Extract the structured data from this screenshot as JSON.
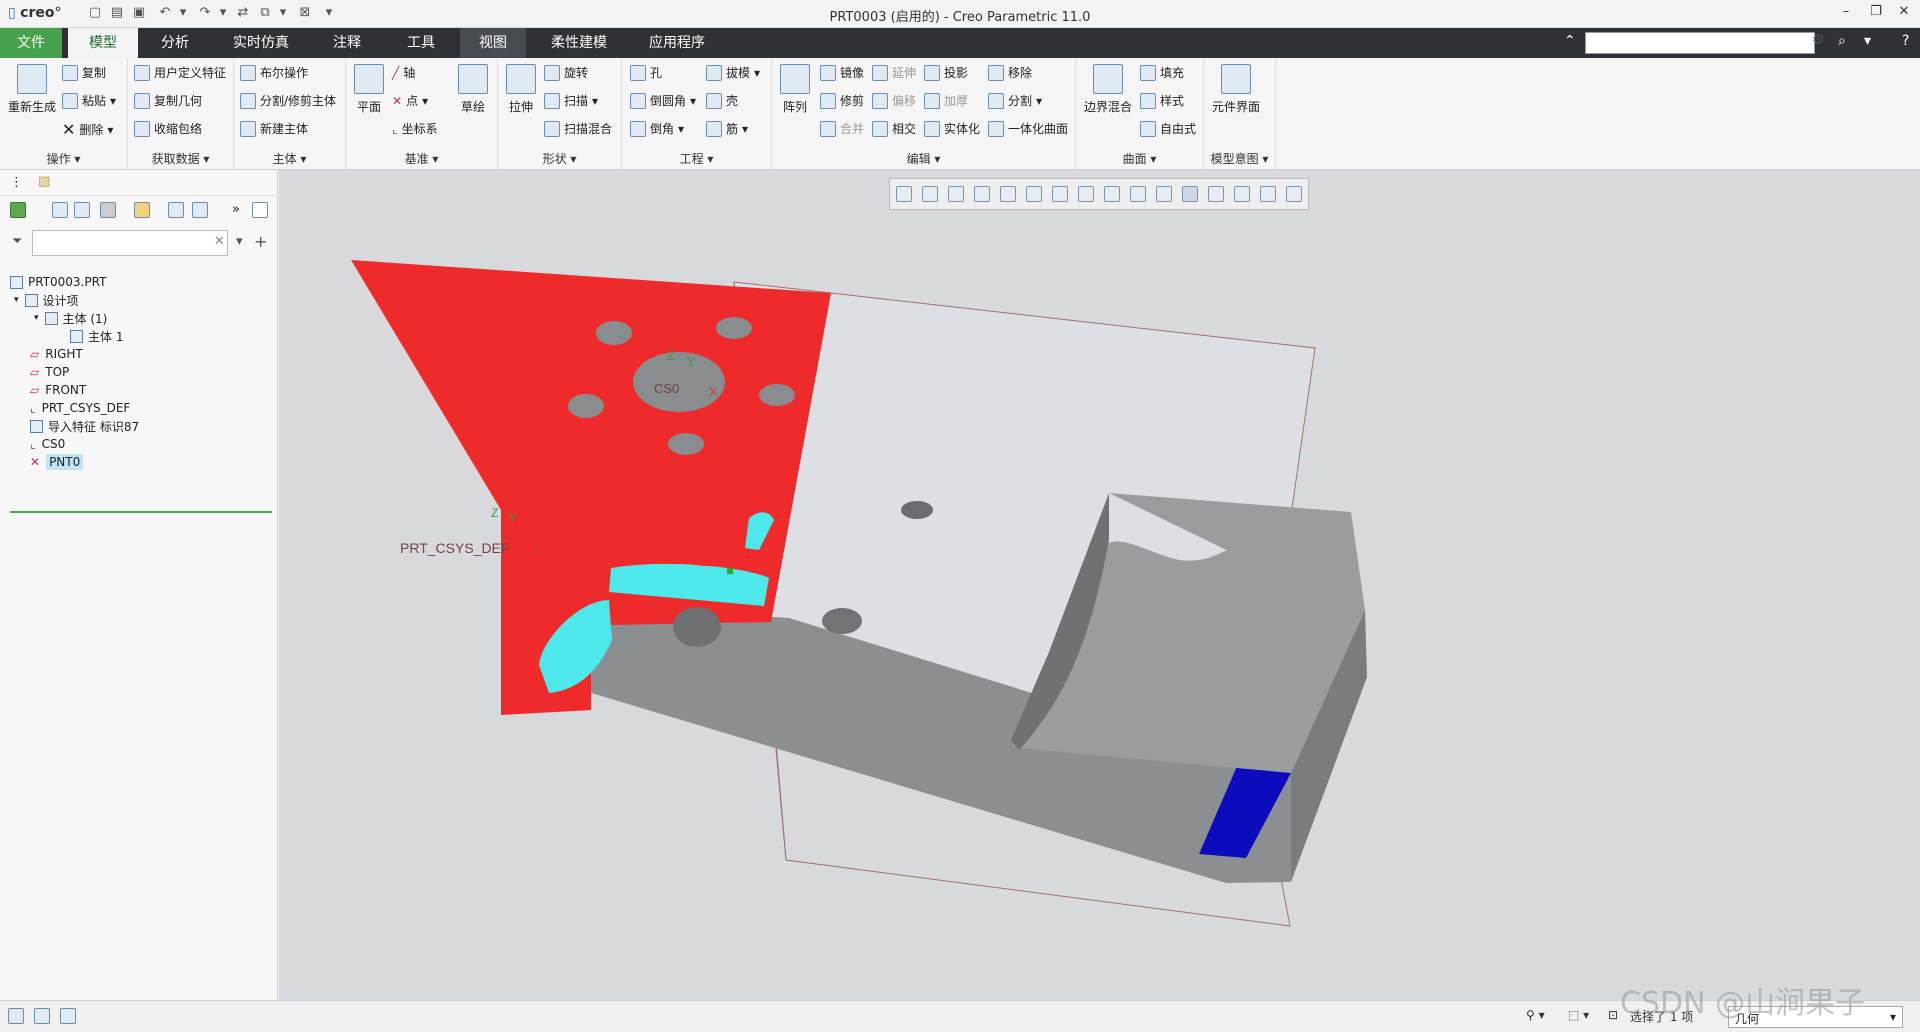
{
  "titlebar": {
    "logo_prefix": "creo",
    "window_title": "PRT0003 (启用的) - Creo Parametric 11.0",
    "min": "–",
    "restore": "❐",
    "close": "✕"
  },
  "menubar": {
    "tabs": [
      "文件",
      "模型",
      "分析",
      "实时仿真",
      "注释",
      "工具",
      "视图",
      "柔性建模",
      "应用程序"
    ],
    "active_tab": "模型",
    "search_placeholder": "",
    "help": "?"
  },
  "ribbon": {
    "operations": {
      "label": "操作",
      "regen": "重新生成",
      "copy": "复制",
      "paste": "粘贴",
      "delete": "删除"
    },
    "getdata": {
      "label": "获取数据",
      "udf": "用户定义特征",
      "copygeom": "复制几何",
      "shrinkwrap": "收缩包络"
    },
    "body": {
      "label": "主体",
      "boolean": "布尔操作",
      "split": "分割/修剪主体",
      "newbody": "新建主体"
    },
    "datum": {
      "label": "基准",
      "plane": "平面",
      "axis": "轴",
      "point": "点",
      "csys": "坐标系",
      "sketch": "草绘"
    },
    "shapes": {
      "label": "形状",
      "extrude": "拉伸",
      "revolve": "旋转",
      "sweep": "扫描",
      "sweptblend": "扫描混合"
    },
    "engineering": {
      "label": "工程",
      "hole": "孔",
      "round": "倒圆角",
      "chamfer": "倒角",
      "draft": "拔模",
      "shell": "壳",
      "rib": "筋"
    },
    "editing": {
      "label": "编辑",
      "pattern": "阵列",
      "mirror": "镜像",
      "extend": "延伸",
      "project": "投影",
      "trim": "修剪",
      "offset": "偏移",
      "thicken": "加厚",
      "merge": "合并",
      "intersect": "相交",
      "solidify": "实体化",
      "remove": "移除",
      "split": "分割",
      "unify": "一体化曲面"
    },
    "surfaces": {
      "label": "曲面",
      "boundary": "边界混合",
      "fill": "填充",
      "style": "样式",
      "freestyle": "自由式"
    },
    "intent": {
      "label": "模型意图",
      "component_interface": "元件界面"
    }
  },
  "tree": {
    "items": [
      {
        "label": "PRT0003.PRT",
        "indent": 0
      },
      {
        "label": "设计项",
        "indent": 1
      },
      {
        "label": "主体 (1)",
        "indent": 2
      },
      {
        "label": "主体 1",
        "indent": 3
      },
      {
        "label": "RIGHT",
        "indent": 1
      },
      {
        "label": "TOP",
        "indent": 1
      },
      {
        "label": "FRONT",
        "indent": 1
      },
      {
        "label": "PRT_CSYS_DEF",
        "indent": 1
      },
      {
        "label": "导入特征 标识87",
        "indent": 1
      },
      {
        "label": "CS0",
        "indent": 1
      },
      {
        "label": "PNT0",
        "indent": 1
      }
    ],
    "selected": "PNT0"
  },
  "viewport": {
    "csys_label": "PRT_CSYS_DEF",
    "cs0_label": "CS0",
    "axis_x": "X",
    "axis_y": "Y",
    "axis_z": "Z"
  },
  "colors": {
    "red": "#ee2a2a",
    "cyan": "#4de8ea",
    "grey": "#8a8d8f",
    "blue": "#0c0cbe",
    "bg": "#d7d9dd"
  },
  "statusbar": {
    "selection": "选择了 1 项",
    "filter": "几何"
  },
  "watermark": "CSDN @山涧果子"
}
